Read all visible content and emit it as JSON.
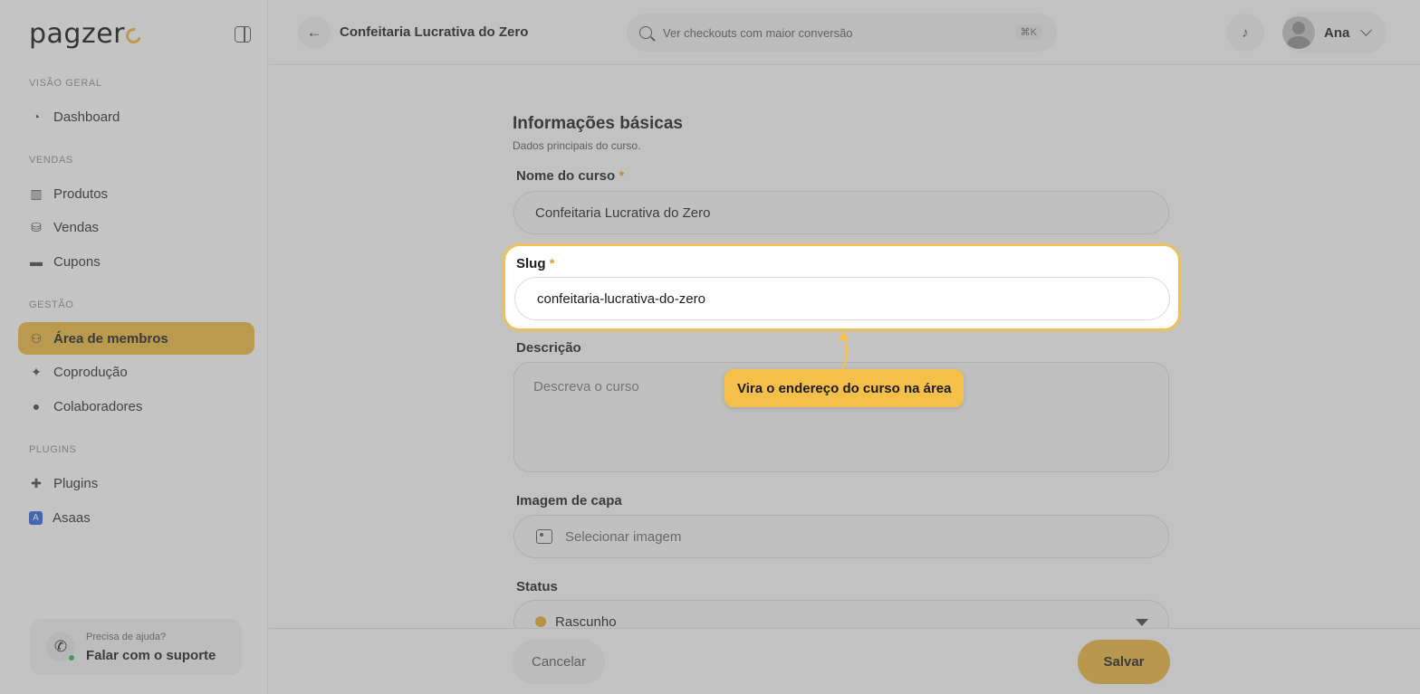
{
  "sidebar": {
    "logo": "pagzer",
    "sections": [
      {
        "label": "VISÃO GERAL",
        "items": [
          {
            "label": "Dashboard",
            "icon": "dashboard-icon"
          }
        ]
      },
      {
        "label": "VENDAS",
        "items": [
          {
            "label": "Produtos",
            "icon": "products-icon"
          },
          {
            "label": "Vendas",
            "icon": "sales-icon"
          },
          {
            "label": "Cupons",
            "icon": "coupon-icon"
          }
        ]
      },
      {
        "label": "GESTÃO",
        "items": [
          {
            "label": "Área de membros",
            "icon": "members-icon"
          },
          {
            "label": "Coprodução",
            "icon": "handshake-icon"
          },
          {
            "label": "Colaboradores",
            "icon": "user-icon"
          }
        ]
      },
      {
        "label": "PLUGINS",
        "items": [
          {
            "label": "Plugins",
            "icon": "puzzle-icon"
          },
          {
            "label": "Asaas",
            "icon": "asaas-icon"
          }
        ]
      }
    ],
    "help": {
      "title": "Precisa de ajuda?",
      "action": "Falar com o suporte"
    }
  },
  "header": {
    "title": "Confeitaria Lucrativa do Zero",
    "search_placeholder": "Ver checkouts com maior conversão",
    "shortcut": "⌘K",
    "user_name": "Ana"
  },
  "form": {
    "title": "Informações básicas",
    "subtitle": "Dados principais do curso.",
    "name_label": "Nome do curso",
    "name_value": "Confeitaria Lucrativa do Zero",
    "slug_label": "Slug",
    "slug_value": "confeitaria-lucrativa-do-zero",
    "description_label": "Descrição",
    "description_placeholder": "Descreva o curso",
    "cover_label": "Imagem de capa",
    "cover_button": "Selecionar imagem",
    "status_label": "Status",
    "status_value": "Rascunho",
    "required_mark": "*"
  },
  "tooltip": "Vira o endereço do curso na área",
  "footer": {
    "cancel": "Cancelar",
    "save": "Salvar"
  },
  "colors": {
    "accent": "#e8b53c",
    "highlight_border": "#f2c14a"
  }
}
